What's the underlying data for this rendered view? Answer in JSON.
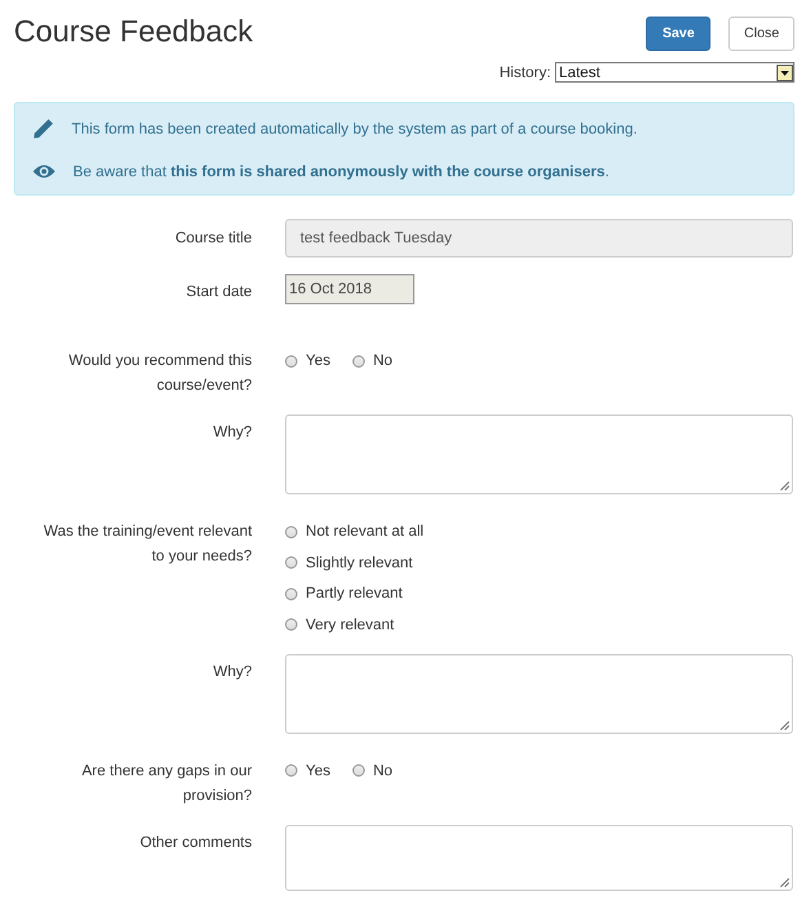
{
  "header": {
    "title": "Course Feedback",
    "buttons": [
      {
        "label": "Save",
        "kind": "primary"
      },
      {
        "label": "Close",
        "kind": "default"
      }
    ],
    "history": {
      "label": "History:",
      "value": "Latest"
    }
  },
  "alert": {
    "lines": [
      {
        "kind": "pencil",
        "text": "This form has been created automatically by the system as part of a course booking."
      },
      {
        "kind": "eye",
        "text": "Be aware that **this form is shared anonymously with the course organisers**."
      }
    ]
  },
  "fields": [
    {
      "kind": "text",
      "label": "Course title",
      "value": "test feedback Tuesday"
    },
    {
      "kind": "date",
      "label": "Start date",
      "value": "16 Oct 2018"
    },
    {
      "kind": "radio",
      "inline": true,
      "label": "Would you recommend this course/event?",
      "options": [
        {
          "label": "Yes",
          "selected": false
        },
        {
          "label": "No",
          "selected": false
        }
      ]
    },
    {
      "kind": "textarea",
      "label": "Why?"
    },
    {
      "kind": "radio",
      "inline": false,
      "label": "Was the training/event relevant to your needs?",
      "options": [
        {
          "label": "Not relevant at all",
          "selected": false
        },
        {
          "label": "Slightly relevant",
          "selected": false
        },
        {
          "label": "Partly relevant",
          "selected": false
        },
        {
          "label": "Very relevant",
          "selected": false
        }
      ]
    },
    {
      "kind": "textarea",
      "label": "Why?"
    },
    {
      "kind": "radio",
      "inline": true,
      "label": "Are there any gaps in our provision?",
      "options": [
        {
          "label": "Yes",
          "selected": false
        },
        {
          "label": "No",
          "selected": false
        }
      ]
    },
    {
      "kind": "textarea",
      "label": "Other comments"
    }
  ]
}
